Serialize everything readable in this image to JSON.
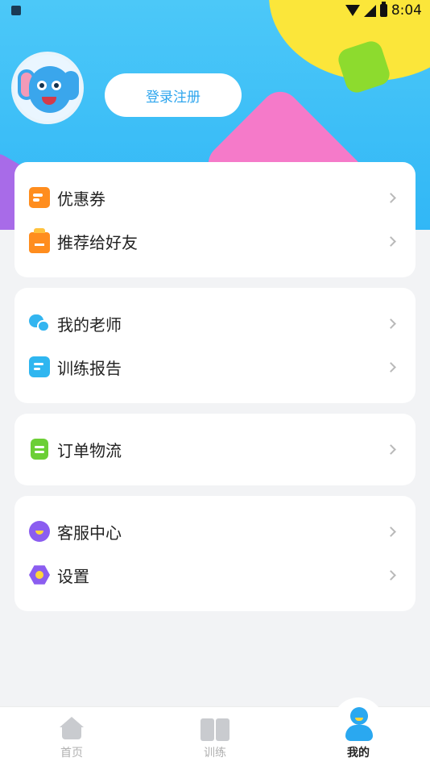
{
  "status_bar": {
    "time": "8:04"
  },
  "header": {
    "login_button": "登录注册"
  },
  "cards": [
    {
      "items": [
        {
          "label": "优惠券",
          "icon": "coupon-icon"
        },
        {
          "label": "推荐给好友",
          "icon": "gift-icon"
        }
      ]
    },
    {
      "items": [
        {
          "label": "我的老师",
          "icon": "chat-icon"
        },
        {
          "label": "训练报告",
          "icon": "report-icon"
        }
      ]
    },
    {
      "items": [
        {
          "label": "订单物流",
          "icon": "order-icon"
        }
      ]
    },
    {
      "items": [
        {
          "label": "客服中心",
          "icon": "service-icon"
        },
        {
          "label": "设置",
          "icon": "settings-icon"
        }
      ]
    }
  ],
  "tabbar": {
    "tabs": [
      {
        "label": "首页",
        "icon": "home-icon",
        "active": false
      },
      {
        "label": "训练",
        "icon": "book-icon",
        "active": false
      },
      {
        "label": "我的",
        "icon": "person-icon",
        "active": true
      }
    ]
  },
  "colors": {
    "header_blue": "#31b7f6",
    "accent_orange": "#ff8d1e",
    "accent_purple": "#8b5df0",
    "login_text": "#2fa6ee"
  }
}
